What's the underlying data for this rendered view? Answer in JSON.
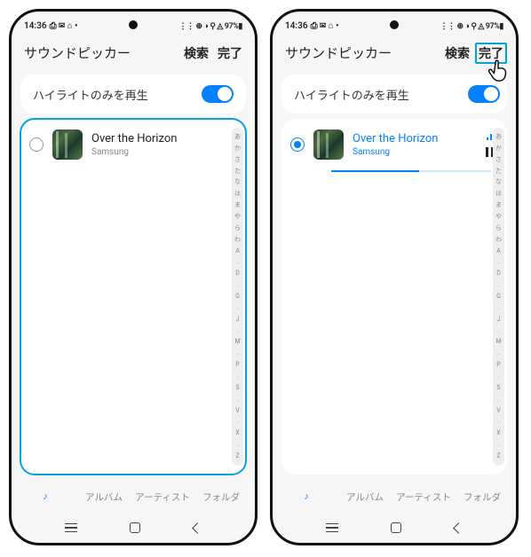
{
  "status": {
    "time": "14:36",
    "left_icons": "⎙ ✉ ⌂ •",
    "right_icons": "⋮⋮ ⊕ ◑ ⚲ ◬ 97%▮",
    "battery_pct": "97%"
  },
  "header": {
    "title": "サウンドピッカー",
    "search_label": "検索",
    "done_label": "完了"
  },
  "highlight_card": {
    "label": "ハイライトのみを再生",
    "toggle_on": true
  },
  "track": {
    "title": "Over the Horizon",
    "artist": "Samsung",
    "progress_pct": 55
  },
  "index_letters": [
    "あ",
    "か",
    "さ",
    "た",
    "な",
    "は",
    "ま",
    "や",
    "ら",
    "わ",
    "A",
    ".",
    "D",
    ".",
    "G",
    ".",
    "J",
    ".",
    "M",
    ".",
    "P",
    ".",
    "S",
    ".",
    "V",
    ".",
    "X",
    ".",
    "Z"
  ],
  "tabs": {
    "tracks_label": "曲",
    "albums_label": "アルバム",
    "artists_label": "アーティスト",
    "folders_label": "フォルダ"
  }
}
